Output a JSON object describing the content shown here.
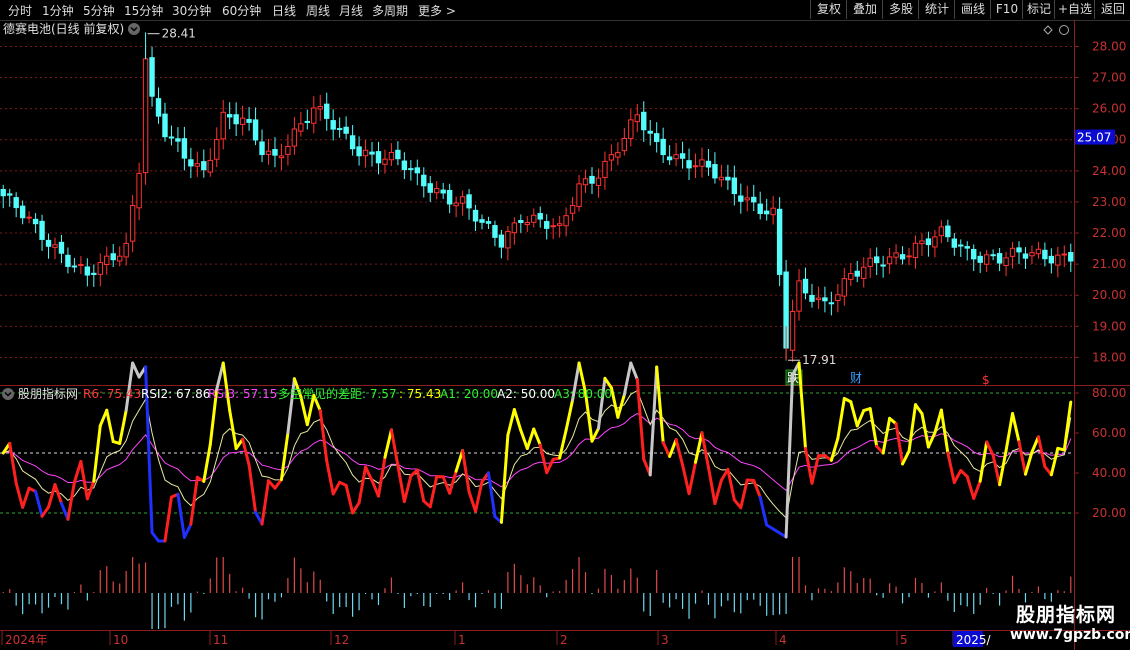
{
  "toolbar": {
    "periods": [
      {
        "label": "分时",
        "active": false
      },
      {
        "label": "1分钟",
        "active": false
      },
      {
        "label": "5分钟",
        "active": false
      },
      {
        "label": "15分钟",
        "active": false
      },
      {
        "label": "30分钟",
        "active": false
      },
      {
        "label": "60分钟",
        "active": false
      },
      {
        "label": "日线",
        "active": true
      },
      {
        "label": "周线",
        "active": false
      },
      {
        "label": "月线",
        "active": false
      },
      {
        "label": "多周期",
        "active": false
      },
      {
        "label": "更多 >",
        "active": false
      }
    ],
    "right_buttons": [
      "复权",
      "叠加",
      "多股",
      "统计",
      "画线",
      "F10",
      "标记",
      "+自选",
      "返回"
    ]
  },
  "main_panel": {
    "title": "德赛电池(日线 前复权)",
    "price_axis": [
      "28.00",
      "27.00",
      "26.00",
      "25.00",
      "24.00",
      "23.00",
      "22.00",
      "21.00",
      "20.00",
      "19.00",
      "18.00"
    ],
    "current_price": "25.07",
    "high_marker": "28.41",
    "low_marker": "17.91",
    "event_markers": [
      {
        "text": "跌",
        "style": "box-green"
      },
      {
        "text": "财",
        "style": "blue"
      },
      {
        "text": "$",
        "style": "red"
      }
    ]
  },
  "indicator_panel": {
    "name": "股朋指标网",
    "readouts": [
      {
        "text": "R6: 75.43",
        "color": "#ff3b3b"
      },
      {
        "text": "RSI2: 67.86",
        "color": "#ffffff"
      },
      {
        "text": "RSI3: 57.15",
        "color": "#ff44ff"
      },
      {
        "text": "多空常见的差距: 7.57",
        "color": "#33ee33"
      },
      {
        "text": ": 75.43",
        "color": "#ffff00"
      },
      {
        "text": "A1: 20.00",
        "color": "#33ee33"
      },
      {
        "text": "A2: 50.00",
        "color": "#ffffff"
      },
      {
        "text": "A3: 80.00",
        "color": "#33ee33"
      }
    ],
    "axis": [
      "80.00",
      "60.00",
      "40.00",
      "20.00"
    ]
  },
  "time_axis": [
    "2024年",
    "10",
    "11",
    "12",
    "1",
    "2",
    "3",
    "4",
    "5",
    "2025/"
  ],
  "watermark": {
    "name": "股朋指标网",
    "url": "www.7gpzb.com"
  },
  "colors": {
    "up": "#ff3232",
    "down": "#54fcfc",
    "grid": "#7a1a1a",
    "axis_text": "#c83232"
  }
}
